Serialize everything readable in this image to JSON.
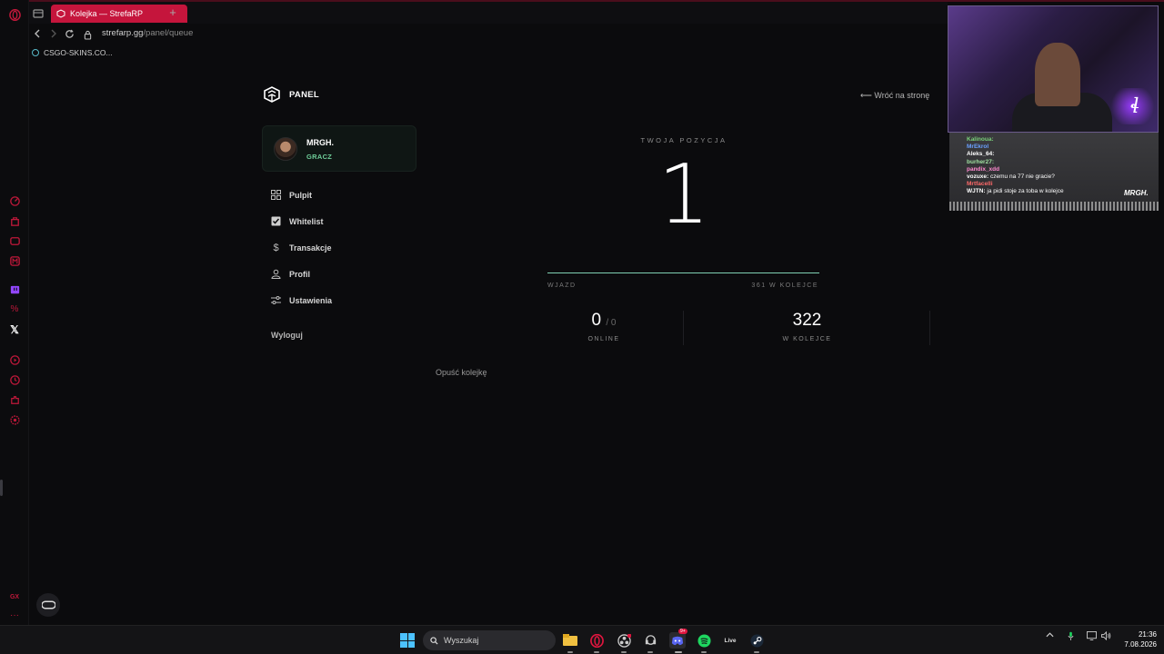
{
  "browser": {
    "tab_title": "Kolejka — StrefaRP",
    "new_tab": "+",
    "url_domain": "strefarp.gg",
    "url_path": "/panel/queue",
    "bookmark": "CSGO-SKINS.CO...",
    "accent": "#c5153c"
  },
  "panel": {
    "logo_text": "PANEL",
    "back_link": "⟵ Wróć na stronę",
    "user": {
      "name": "MRGH.",
      "role": "GRACZ"
    },
    "nav": [
      {
        "label": "Pulpit",
        "icon": "grid-icon"
      },
      {
        "label": "Whitelist",
        "icon": "checkbox-icon"
      },
      {
        "label": "Transakcje",
        "icon": "dollar-icon"
      },
      {
        "label": "Profil",
        "icon": "user-icon"
      },
      {
        "label": "Ustawienia",
        "icon": "sliders-icon"
      }
    ],
    "logout": "Wyloguj",
    "leave_queue": "Opuść kolejkę"
  },
  "queue": {
    "position_label": "TWOJA POZYCJA",
    "position": "1",
    "progress_left": "WJAZD",
    "progress_right": "361 W KOLEJCE",
    "progress_fraction": 1.0,
    "online_value": "0",
    "online_max": "/ 0",
    "online_label": "ONLINE",
    "queue_value": "322",
    "queue_label": "W KOLEJCE",
    "accent": "#7fd0b2"
  },
  "stream_chat": [
    {
      "user": "Kalinoua:",
      "msg": "",
      "color": "#7ad17a"
    },
    {
      "user": "MrEkrol",
      "msg": "",
      "color": "#6aa0ff"
    },
    {
      "user": "Aleks_64:",
      "msg": "",
      "color": "#ffffff"
    },
    {
      "user": "burher27:",
      "msg": "",
      "color": "#9fe0a0"
    },
    {
      "user": "pandix_xdd",
      "msg": "",
      "color": "#ff8ad0"
    },
    {
      "user": "vozuxe:",
      "msg": "czemu na 77 nie gracie?",
      "color": "#ffffff"
    },
    {
      "user": "Mrtfacelli",
      "msg": "",
      "color": "#ff6a6a"
    },
    {
      "user": "WJTN:",
      "msg": "ja pidi stoje za toba w kolejce",
      "color": "#ffffff"
    }
  ],
  "stream_logo": "MRGH.",
  "taskbar": {
    "search_placeholder": "Wyszukaj",
    "live_label": "Live",
    "discord_badge": "9+",
    "time": "21:36",
    "date": "7.08.2026"
  }
}
